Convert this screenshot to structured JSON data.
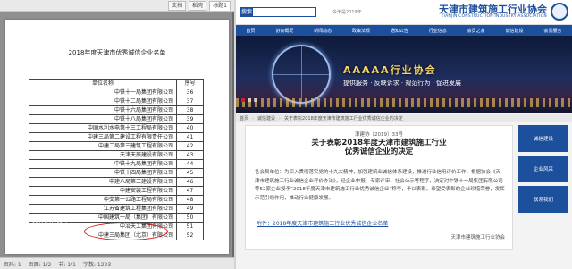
{
  "doc": {
    "tabs": [
      "文档",
      "稻壳",
      "标题1"
    ],
    "heading": "2018年度天津市优秀诚信企业名单",
    "table_headers": [
      "序号",
      "单位名称"
    ],
    "rows": [
      {
        "no": "36",
        "unit": "中铁十一局集团有限公司"
      },
      {
        "no": "37",
        "unit": "中铁十二局集团有限公司"
      },
      {
        "no": "38",
        "unit": "中铁十六局集团有限公司"
      },
      {
        "no": "39",
        "unit": "中铁十八局集团有限公司"
      },
      {
        "no": "40",
        "unit": "中国水利水电第十三工程局有限公司"
      },
      {
        "no": "41",
        "unit": "中建三局第二建设工程有限责任公司"
      },
      {
        "no": "42",
        "unit": "中建二局第三建筑工程有限公司"
      },
      {
        "no": "43",
        "unit": "天津天辰建设有限公司"
      },
      {
        "no": "44",
        "unit": "中铁十九局集团有限公司"
      },
      {
        "no": "45",
        "unit": "中铁十四局集团有限公司"
      },
      {
        "no": "46",
        "unit": "中建八局第三建设有限公司"
      },
      {
        "no": "47",
        "unit": "中建安装工程有限公司"
      },
      {
        "no": "48",
        "unit": "中交第一公路工程局有限公司"
      },
      {
        "no": "49",
        "unit": "江苏省建筑工程集团有限公司"
      },
      {
        "no": "50",
        "unit": "中国建筑一局（集团）有限公司"
      },
      {
        "no": "51",
        "unit": "中冶天工集团有限公司"
      },
      {
        "no": "52",
        "unit": "中建三局集团（北京）有限公司"
      }
    ],
    "watermark_title": "激活 Windows",
    "watermark_sub": "转到“设置”以激活 Windows。",
    "status": [
      "页码: 1",
      "页面: 1/2",
      "节: 1/1",
      "字数: 1223"
    ]
  },
  "web": {
    "site_name": "天津市建筑施工行业协会",
    "site_name_en": "TIANJIN CONSTRUCTION INDUSTRY ASSOCIATION",
    "search_button": "搜索",
    "header_date": "今天是2019年",
    "nav": [
      "首页",
      "协会概况",
      "新闻动态",
      "政策法规",
      "通知公告",
      "行业信息",
      "会员之家",
      "诚信建设",
      "会员服务"
    ],
    "banner_slogan": "AAAAA行业协会",
    "banner_sub": "提供服务 · 反映诉求 · 规范行为 · 促进发展",
    "breadcrumb": [
      "首页",
      "诚信建设",
      "关于表彰2018年度天津市建筑施工行业优秀诚信企业的决定"
    ],
    "article": {
      "doc_no": "津建协〔2019〕33号",
      "title_line1": "关于表彰2018年度天津市建筑施工行业",
      "title_line2": "优秀诚信企业的决定",
      "body": "各会员单位：为深入贯彻落实党的十九大精神，加强建筑业诚信体系建设，推进行业信用评价工作，根据协会《天津市建筑施工行业诚信企业评价办法》，经企业申报、专家评审、社会公示等程序，决定对中铁十一局集团有限公司等52家企业授予“2018年度天津市建筑施工行业优秀诚信企业”称号，予以表彰。希望受表彰的企业珍惜荣誉，发挥示范引领作用，推动行业健康发展。",
      "attachment": "附件：2018年度天津市建筑施工行业优秀诚信企业名单",
      "footer": "天津市建筑施工行业协会"
    },
    "sidebar": [
      "诚信建设",
      "企业风采",
      "联系我们"
    ]
  }
}
